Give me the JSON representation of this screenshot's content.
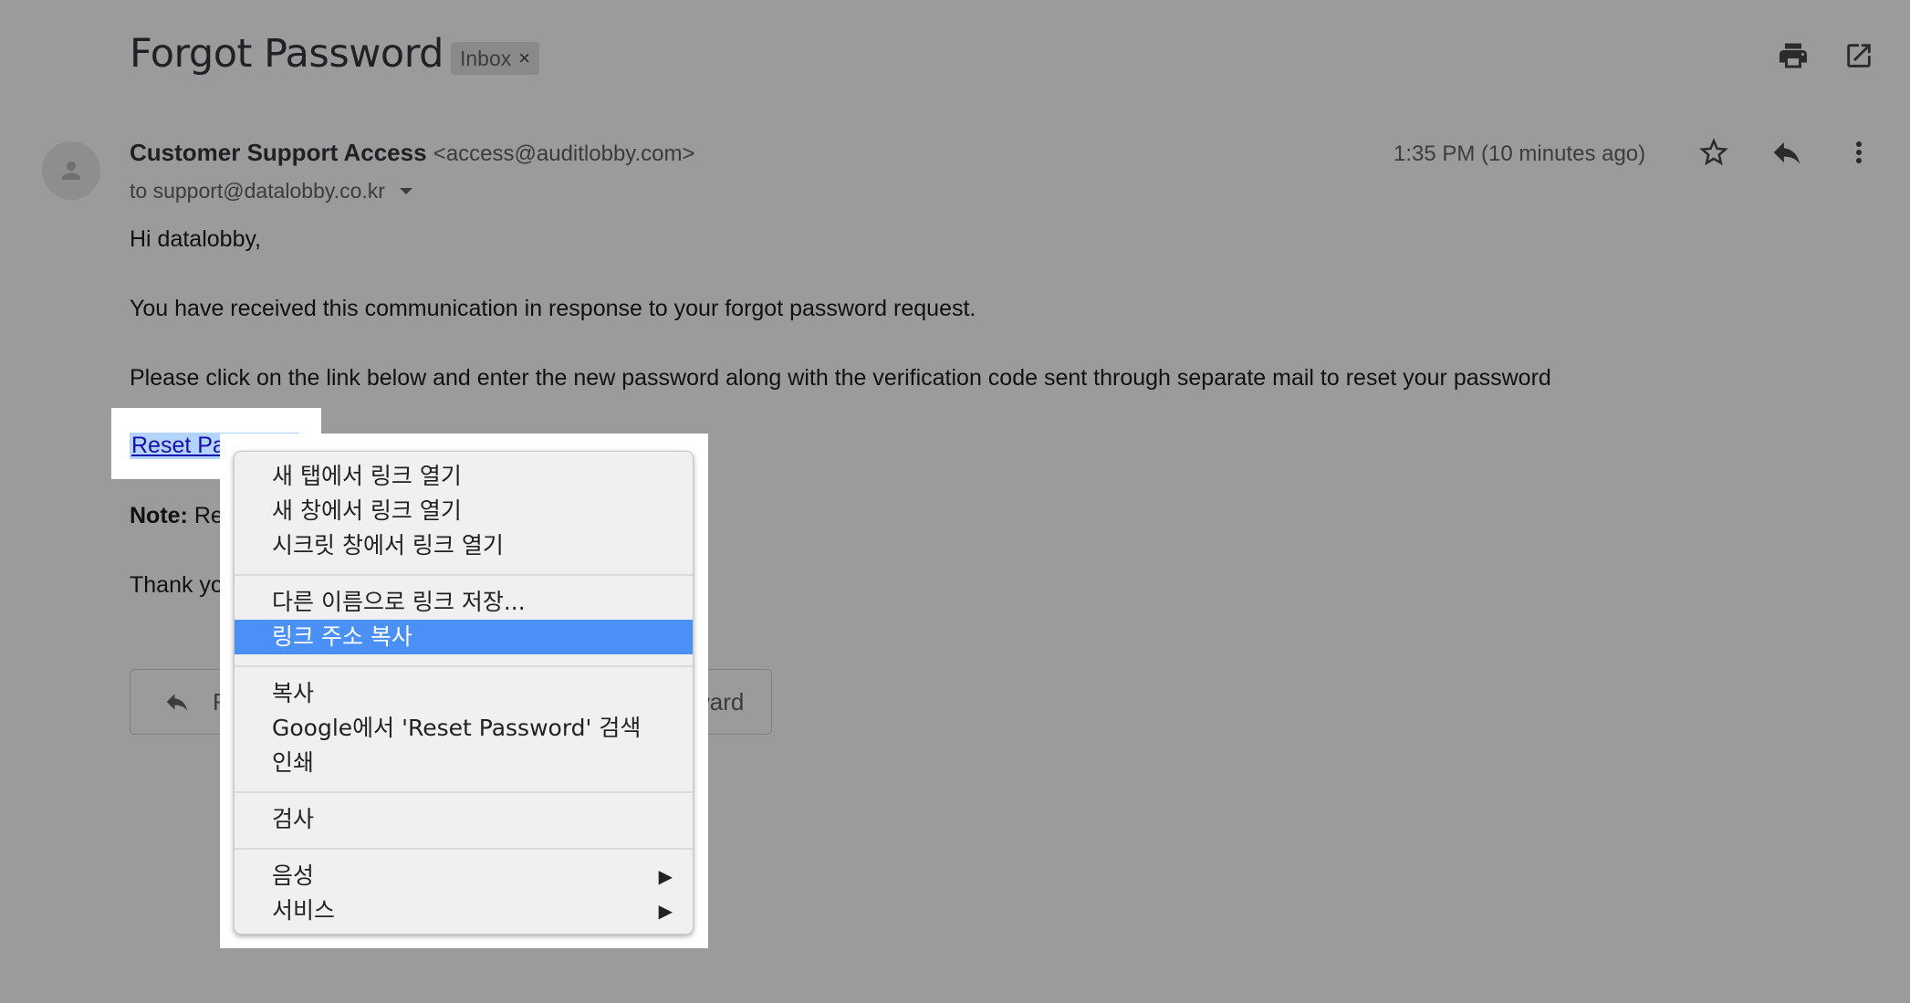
{
  "email": {
    "subject": "Forgot Password",
    "label": "Inbox",
    "label_close": "×",
    "sender_name": "Customer Support Access",
    "sender_email": "<access@auditlobby.com>",
    "to": "to support@datalobby.co.kr",
    "time": "1:35 PM (10 minutes ago)",
    "greeting": "Hi datalobby,",
    "para1": "You have received this communication in response to your forgot password request.",
    "para2": "Please click on the link below and enter the new password along with the verification code sent through separate mail to reset your password",
    "link_text": "Reset Password",
    "note_label": "Note:",
    "note_text": "Res",
    "thanks": "Thank you",
    "reply_button": "Re",
    "forward_button": "ward"
  },
  "context_menu": {
    "group1": [
      "새 탭에서 링크 열기",
      "새 창에서 링크 열기",
      "시크릿 창에서 링크 열기"
    ],
    "group2": [
      "다른 이름으로 링크 저장...",
      "링크 주소 복사"
    ],
    "group3": [
      "복사",
      "Google에서 'Reset Password' 검색",
      "인쇄"
    ],
    "group4": [
      "검사"
    ],
    "group5": [
      "음성",
      "서비스"
    ],
    "selected": "링크 주소 복사",
    "submenu_arrow": "▶"
  },
  "icons": {
    "print": "print-icon",
    "popout": "open-in-new-window-icon",
    "star": "star-icon",
    "reply": "reply-icon",
    "more": "more-vert-icon",
    "avatar": "person-icon"
  },
  "colors": {
    "overlay_bg": "#9b9b9b",
    "link": "#1a0dab",
    "menu_selected": "#4a90f6"
  }
}
